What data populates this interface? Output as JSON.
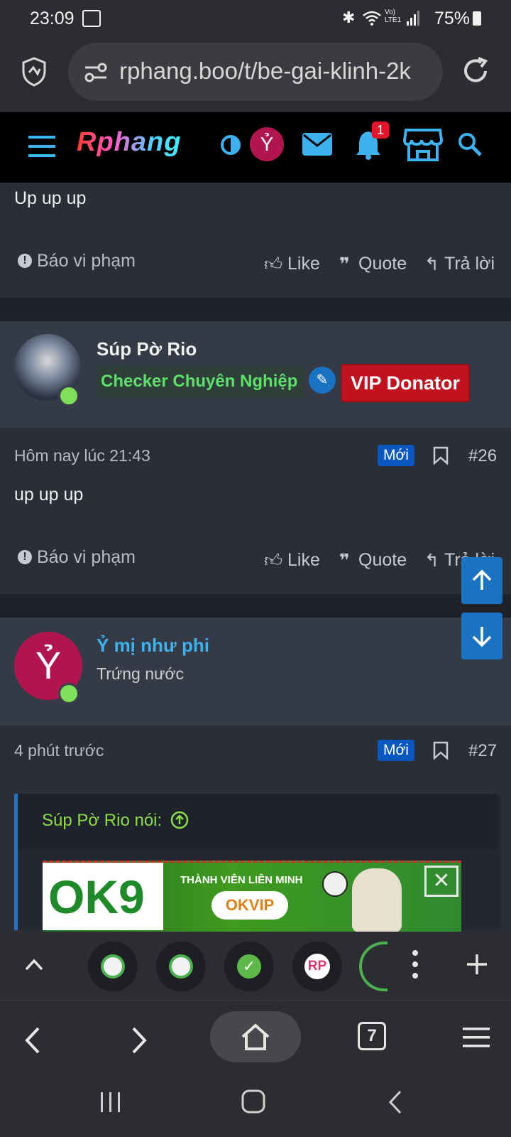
{
  "status": {
    "time": "23:09",
    "battery": "75%",
    "network": "Vo) LTE1"
  },
  "browser": {
    "url": "rphang.boo/t/be-gai-klinh-2k"
  },
  "site": {
    "logo": "Rphang",
    "avatar_letter": "Ỷ",
    "notification_count": "1"
  },
  "post_prev": {
    "body": "Up up up",
    "report": "Báo vi phạm",
    "like": "Like",
    "quote": "Quote",
    "reply": "Trả lời"
  },
  "post26": {
    "username": "Súp Pờ Rio",
    "rank": "Checker Chuyên Nghiệp",
    "vip": "VIP Donator",
    "time": "Hôm nay lúc 21:43",
    "new_badge": "Mới",
    "number": "#26",
    "body": "up up up",
    "report": "Báo vi phạm",
    "like": "Like",
    "quote": "Quote",
    "reply": "Trả lời"
  },
  "post27": {
    "username": "Ỷ mị như phi",
    "avatar_letter": "Ỷ",
    "rank": "Trứng nước",
    "time": "4 phút trước",
    "new_badge": "Mới",
    "number": "#27",
    "quote_head": "Súp Pờ Rio nói:"
  },
  "ad": {
    "brand": "OK9",
    "tagline": "THÀNH VIÊN LIÊN MINH",
    "partner": "OKVIP"
  },
  "tabs": {
    "rp_label": "RP",
    "count": "7"
  },
  "colors": {
    "accent": "#3db2ef",
    "green": "#7ee05a",
    "vip_red": "#c1121f",
    "new_blue": "#0a57c2"
  }
}
